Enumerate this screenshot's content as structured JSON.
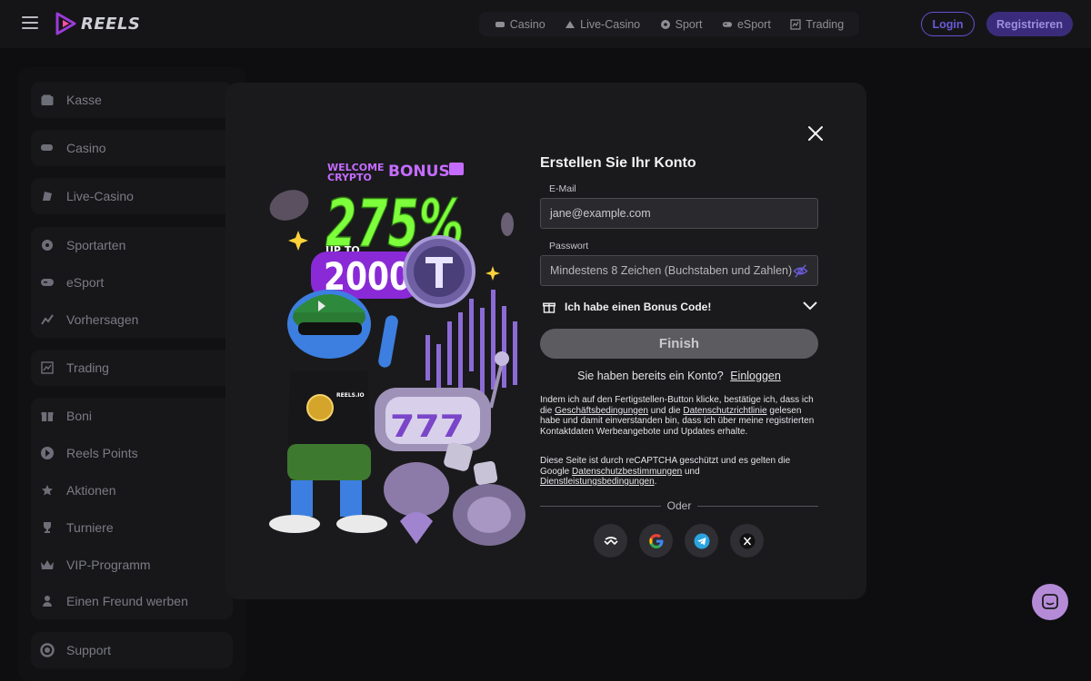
{
  "brand": {
    "logo_text": "REELS"
  },
  "topnav": [
    {
      "label": "Casino",
      "icon": "casino-icon"
    },
    {
      "label": "Live-Casino",
      "icon": "live-casino-icon"
    },
    {
      "label": "Sport",
      "icon": "soccer-ball-icon"
    },
    {
      "label": "eSport",
      "icon": "gamepad-icon"
    },
    {
      "label": "Trading",
      "icon": "trading-chart-icon"
    }
  ],
  "auth": {
    "login_label": "Login",
    "register_label": "Registrieren"
  },
  "sidebar": {
    "items": [
      {
        "label": "Kasse",
        "icon": "wallet-icon",
        "expandable": true
      },
      {
        "label": "Casino",
        "icon": "casino-icon",
        "expandable": true
      },
      {
        "label": "Live-Casino",
        "icon": "live-casino-icon",
        "expandable": true
      },
      {
        "label": "Sportarten",
        "icon": "soccer-ball-icon",
        "expandable": false
      },
      {
        "label": "eSport",
        "icon": "gamepad-icon",
        "expandable": false
      },
      {
        "label": "Vorhersagen",
        "icon": "trend-icon",
        "expandable": false
      },
      {
        "label": "Trading",
        "icon": "trading-chart-icon",
        "expandable": true
      },
      {
        "label": "Boni",
        "icon": "gift-icon",
        "expandable": false
      },
      {
        "label": "Reels Points",
        "icon": "reels-points-icon",
        "expandable": false
      },
      {
        "label": "Aktionen",
        "icon": "star-icon",
        "expandable": false
      },
      {
        "label": "Turniere",
        "icon": "trophy-icon",
        "expandable": false
      },
      {
        "label": "VIP-Programm",
        "icon": "crown-icon",
        "expandable": false
      },
      {
        "label": "Einen Freund werben",
        "icon": "user-icon",
        "expandable": false
      },
      {
        "label": "Support",
        "icon": "support-icon",
        "expandable": false
      }
    ]
  },
  "promo": {
    "welcome_line1": "WELCOME",
    "welcome_line2": "CRYPTO",
    "bonus_word": "BONUS",
    "percent": "275%",
    "up_to": "UP TO",
    "amount": "2000",
    "slot_digits": "777",
    "shirt_text": "REELS.IO"
  },
  "form": {
    "title": "Erstellen Sie Ihr Konto",
    "email_label": "E-Mail",
    "email_value": "jane@example.com",
    "password_label": "Passwort",
    "password_placeholder": "Mindestens 8 Zeichen (Buchstaben und Zahlen)",
    "bonus_code_label": "Ich habe einen Bonus Code!",
    "finish_label": "Finish",
    "have_account_text": "Sie haben bereits ein Konto?",
    "login_link": "Einloggen",
    "legal1": {
      "part1": "Indem ich auf den Fertigstellen-Button klicke, bestätige ich, dass ich die ",
      "terms_link": "Geschäftsbedingungen",
      "part2": " und die ",
      "privacy_link": "Datenschutzrichtlinie",
      "part3": " gelesen habe und damit einverstanden bin, dass ich über meine registrierten Kontaktdaten Werbeangebote und Updates erhalte."
    },
    "legal2": {
      "part1": "Diese Seite ist durch reCAPTCHA geschützt und es gelten die Google ",
      "privacy_link": "Datenschutzbestimmungen",
      "part2": " und ",
      "terms_link": "Dienstleistungsbedingungen",
      "part3": "."
    },
    "or_label": "Oder",
    "socials": [
      "wallet-connect-icon",
      "google-icon",
      "telegram-icon",
      "x-icon"
    ]
  },
  "colors": {
    "accent": "#6a4fd1",
    "promo_green": "#7dff3c",
    "promo_purple": "#b24cff",
    "chat_bubble": "#b58bd8"
  }
}
